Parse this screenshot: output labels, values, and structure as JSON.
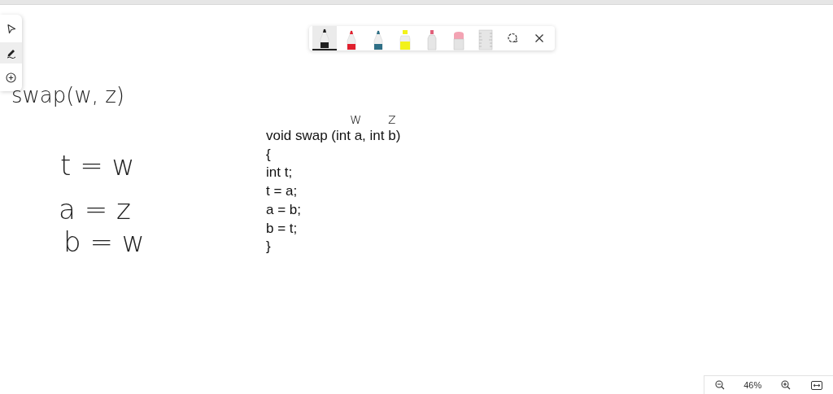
{
  "left_toolbar": {
    "tools": [
      {
        "kind": "select",
        "selected": false
      },
      {
        "kind": "pen",
        "selected": true
      },
      {
        "kind": "add",
        "selected": false
      }
    ]
  },
  "pen_toolbar": {
    "tools": [
      {
        "kind": "pen",
        "color": "#1e1e1e",
        "selected": true
      },
      {
        "kind": "pen",
        "color": "#e0202e",
        "selected": false
      },
      {
        "kind": "pen",
        "color": "#2f6f86",
        "selected": false
      },
      {
        "kind": "highlighter",
        "color": "#f2f21a",
        "selected": false
      },
      {
        "kind": "pencil",
        "color": "#e0607a",
        "selected": false
      },
      {
        "kind": "eraser",
        "selected": false
      },
      {
        "kind": "ruler",
        "selected": false
      },
      {
        "kind": "lasso",
        "selected": false
      },
      {
        "kind": "close",
        "selected": false
      }
    ]
  },
  "canvas": {
    "ink": [
      "swap(w, z)",
      "t = w",
      "a = z",
      "b = w",
      "w",
      "z"
    ],
    "code_lines": [
      "void swap (int a, int b)",
      "{",
      "int t;",
      "t = a;",
      "a = b;",
      "b = t;",
      "}"
    ]
  },
  "zoom_bar": {
    "value": "46%"
  }
}
